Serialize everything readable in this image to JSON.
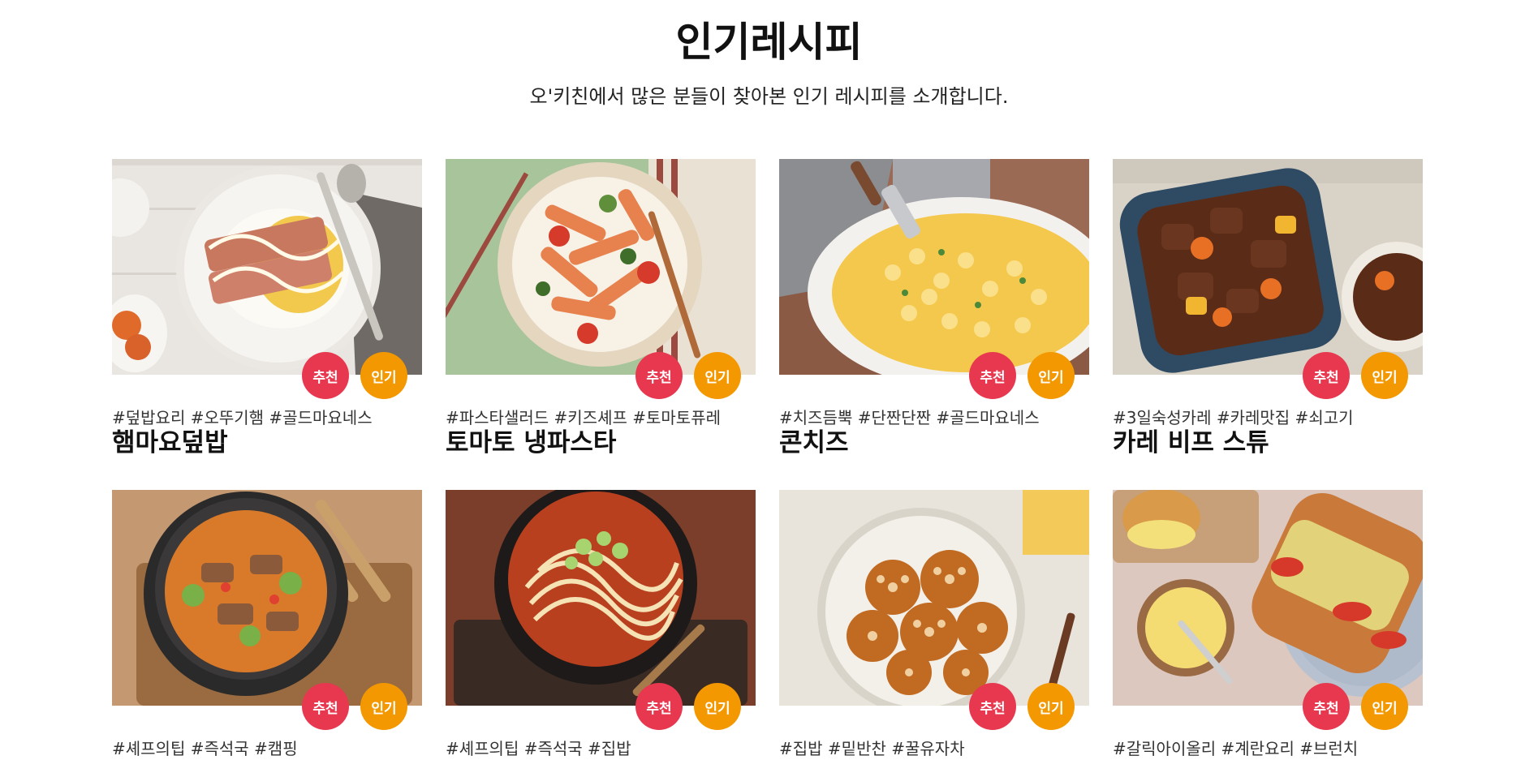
{
  "section": {
    "title": "인기레시피",
    "subtitle": "오'키친에서 많은 분들이 찾아본 인기 레시피를 소개합니다."
  },
  "colors": {
    "recommend_badge": "#e8384f",
    "popular_badge": "#f39800"
  },
  "recipes": [
    {
      "tags": "#덮밥요리 #오뚜기햄 #골드마요네스",
      "name": "햄마요덮밥",
      "badge_recommend": "추천",
      "badge_popular": "인기",
      "image": "ham-mayo-rice-bowl-photo"
    },
    {
      "tags": "#파스타샐러드 #키즈셰프 #토마토퓨레",
      "name": "토마토 냉파스타",
      "badge_recommend": "추천",
      "badge_popular": "인기",
      "image": "tomato-cold-pasta-photo"
    },
    {
      "tags": "#치즈듬뿍 #단짠단짠 #골드마요네스",
      "name": "콘치즈",
      "badge_recommend": "추천",
      "badge_popular": "인기",
      "image": "corn-cheese-photo"
    },
    {
      "tags": "#3일숙성카레 #카레맛집 #쇠고기",
      "name": "카레 비프 스튜",
      "badge_recommend": "추천",
      "badge_popular": "인기",
      "image": "curry-beef-stew-photo"
    },
    {
      "tags": "#셰프의팁 #즉석국 #캠핑",
      "name": "",
      "badge_recommend": "추천",
      "badge_popular": "인기",
      "image": "beef-stew-pot-photo"
    },
    {
      "tags": "#셰프의팁 #즉석국 #집밥",
      "name": "",
      "badge_recommend": "추천",
      "badge_popular": "인기",
      "image": "spicy-udon-photo"
    },
    {
      "tags": "#집밥 #밑반찬 #꿀유자차",
      "name": "",
      "badge_recommend": "추천",
      "badge_popular": "인기",
      "image": "braised-lotus-root-photo"
    },
    {
      "tags": "#갈릭아이올리 #계란요리 #브런치",
      "name": "",
      "badge_recommend": "추천",
      "badge_popular": "인기",
      "image": "egg-sandwich-photo"
    }
  ]
}
